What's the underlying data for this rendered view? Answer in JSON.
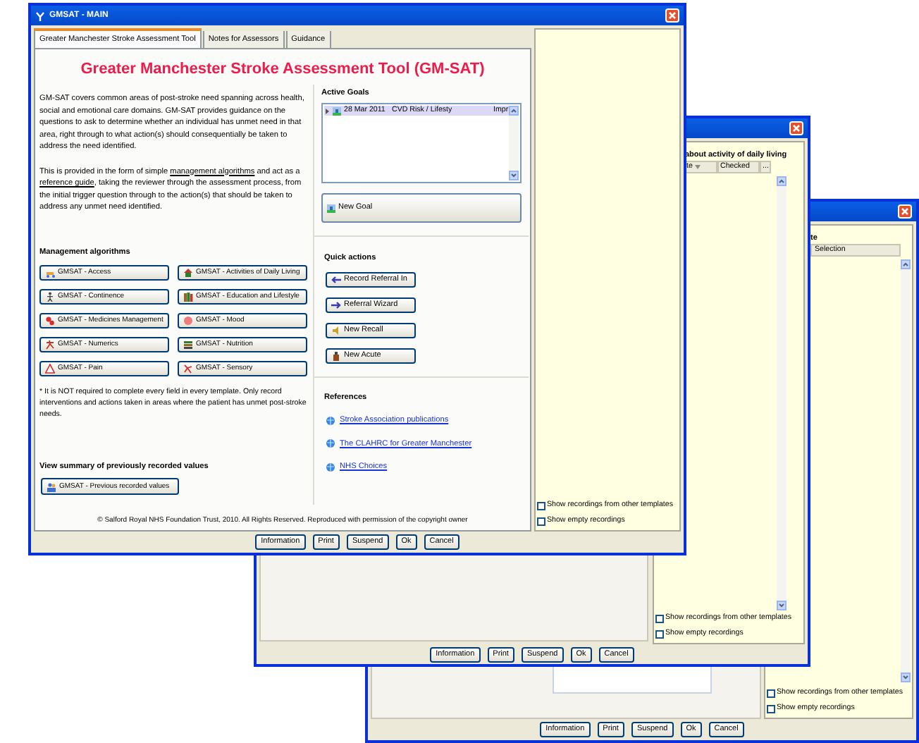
{
  "selection_window": {
    "heading": "te",
    "columns": [
      "Selection"
    ],
    "options": [
      {
        "label": "Show recordings from other templates",
        "checked": false
      },
      {
        "label": "Show empty recordings",
        "checked": false
      }
    ],
    "buttons": [
      "Information",
      "Print",
      "Suspend",
      "Ok",
      "Cancel"
    ]
  },
  "assessment_window": {
    "heading": "about activity of daily living",
    "columns": [
      "te",
      "Checked",
      "..."
    ],
    "options": [
      {
        "label": "Show recordings from other templates",
        "checked": false
      },
      {
        "label": "Show empty recordings",
        "checked": false
      }
    ],
    "buttons": [
      "Information",
      "Print",
      "Suspend",
      "Ok",
      "Cancel"
    ]
  },
  "main_window": {
    "title": "GMSAT - MAIN",
    "tabs": [
      {
        "label": "Greater Manchester Stroke Assessment Tool",
        "selected": true
      },
      {
        "label": "Notes for Assessors",
        "selected": false
      },
      {
        "label": "Guidance",
        "selected": false
      }
    ],
    "heading": "Greater Manchester Stroke Assessment Tool (GM-SAT)",
    "intro": [
      [
        {
          "kind": "text",
          "text": "GM-SAT covers common areas of post-stroke need spanning across health, social and emotional care domains.  GM-SAT provides guidance on the questions to ask to determine whether an individual has unmet need in that area, right through to what action(s) should consequentially be taken to address the need identified."
        }
      ],
      [
        {
          "kind": "text",
          "text": "This is provided in the form of simple "
        },
        {
          "kind": "link",
          "text": "management algorithms"
        },
        {
          "kind": "text",
          "text": " and act as a "
        },
        {
          "kind": "link",
          "text": "reference guide"
        },
        {
          "kind": "text",
          "text": ", taking the reviewer through the assessment process, from the initial trigger question through to the action(s) that should be taken to address any unmet need identified."
        }
      ]
    ],
    "algorithms_label": "Management algorithms",
    "algorithms": [
      "GMSAT - Access",
      "GMSAT - Activities of Daily Living",
      "GMSAT - Continence",
      "GMSAT - Education and Lifestyle",
      "GMSAT - Medicines Management",
      "GMSAT - Mood",
      "GMSAT - Numerics",
      "GMSAT - Nutrition",
      "GMSAT - Pain",
      "GMSAT - Sensory"
    ],
    "note": "* It is NOT required to complete every field in every template.  Only record interventions and actions taken in areas where the patient has unmet post-stroke needs.",
    "summary_label": "View summary of previously recorded values",
    "summary_button": "GMSAT - Previous recorded values",
    "copyright": "© Salford Royal NHS Foundation Trust, 2010.  All Rights Reserved.  Reproduced with permission of the copyright owner",
    "active_goals": {
      "label": "Active Goals",
      "rows": [
        {
          "date": "28 Mar 2011",
          "goal": "CVD Risk / Lifesty",
          "status": "Impr",
          "selected": true
        }
      ],
      "new_goal": "New Goal"
    },
    "quick_actions": {
      "label": "Quick actions",
      "buttons": [
        "Record Referral In",
        "Referral Wizard",
        "New Recall",
        "New Acute"
      ]
    },
    "references": {
      "label": "References",
      "links": [
        "Stroke Association publications",
        "The CLAHRC for Greater Manchester",
        "NHS Choices"
      ]
    },
    "options": [
      {
        "label": "Show recordings from other templates",
        "checked": false
      },
      {
        "label": "Show empty recordings",
        "checked": false
      }
    ],
    "buttons": [
      "Information",
      "Print",
      "Suspend",
      "Ok",
      "Cancel"
    ]
  }
}
